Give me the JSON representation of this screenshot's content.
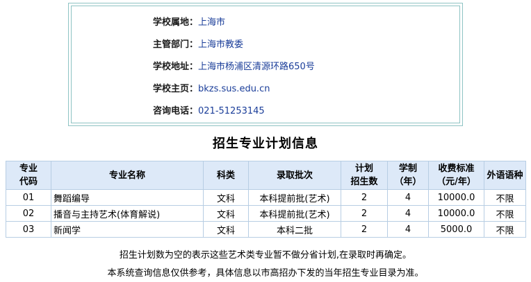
{
  "school_info": [
    {
      "label": "学校属地：",
      "value": "上海市"
    },
    {
      "label": "主管部门：",
      "value": "上海市教委"
    },
    {
      "label": "学校地址：",
      "value": "上海市杨浦区清源环路650号"
    },
    {
      "label": "学校主页：",
      "value": "bkzs.sus.edu.cn"
    },
    {
      "label": "咨询电话：",
      "value": "021-51253145"
    }
  ],
  "section_title": "招生专业计划信息",
  "table": {
    "headers": [
      [
        "专业",
        "代码"
      ],
      [
        "专业名称"
      ],
      [
        "科类"
      ],
      [
        "录取批次"
      ],
      [
        "计划",
        "招生数"
      ],
      [
        "学制",
        "（年）"
      ],
      [
        "收费标准",
        "（元/年）"
      ],
      [
        "外语语种"
      ]
    ],
    "rows": [
      {
        "code": "01",
        "name": "舞蹈编导",
        "category": "文科",
        "batch": "本科提前批(艺术)",
        "plan": "2",
        "years": "4",
        "fee": "10000.0",
        "language": "不限"
      },
      {
        "code": "02",
        "name": "播音与主持艺术(体育解说)",
        "category": "文科",
        "batch": "本科提前批(艺术)",
        "plan": "2",
        "years": "4",
        "fee": "10000.0",
        "language": "不限"
      },
      {
        "code": "03",
        "name": "新闻学",
        "category": "文科",
        "batch": "本科二批",
        "plan": "2",
        "years": "4",
        "fee": "5000.0",
        "language": "不限"
      }
    ]
  },
  "notes": [
    "招生计划数为空的表示这些艺术类专业暂不做分省计划,在录取时再确定。",
    "本系统查询信息仅供参考，具体信息以市高招办下发的当年招生专业目录为准。"
  ],
  "colors": {
    "box_border": "#8ec3c3",
    "value_text": "#1a3d99",
    "header_bg": "#dde9f8",
    "table_border": "#b7cde3"
  }
}
